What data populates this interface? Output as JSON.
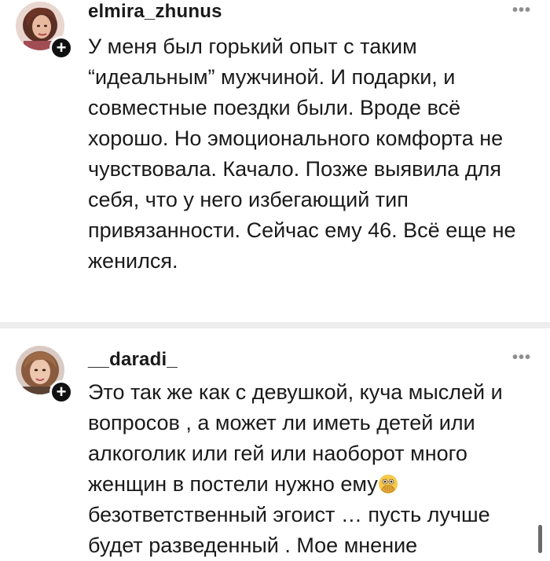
{
  "comments": [
    {
      "username": "elmira_zhunus",
      "more": "•••",
      "plus": "+",
      "text": "У меня был горький опыт с таким\n“идеальным” мужчиной. И подарки, и\nсовместные поездки были. Вроде всё\nхорошо. Но эмоционального комфорта не\nчувствовала. Качало. Позже выявила для\nсебя, что у него избегающий тип\nпривязанности. Сейчас ему 46. Всё еще не\nженился."
    },
    {
      "username": "__daradi_",
      "more": "•••",
      "plus": "+",
      "text_before_emoji": "Это так же как с девушкой, куча мыслей и\nвопросов , а может ли иметь детей или\nалкоголик или гей или наоборот много\nженщин в постели нужно ему",
      "emoji": "face-with-open-eyes-and-hand-over-mouth",
      "text_after_emoji": "\nбезответственный эгоист … пусть лучше\nбудет разведенный . Мое мнение"
    }
  ],
  "colors": {
    "text": "#1a1a1a",
    "divider": "#ededed",
    "muted": "#8e8e8e",
    "badge": "#111111"
  }
}
